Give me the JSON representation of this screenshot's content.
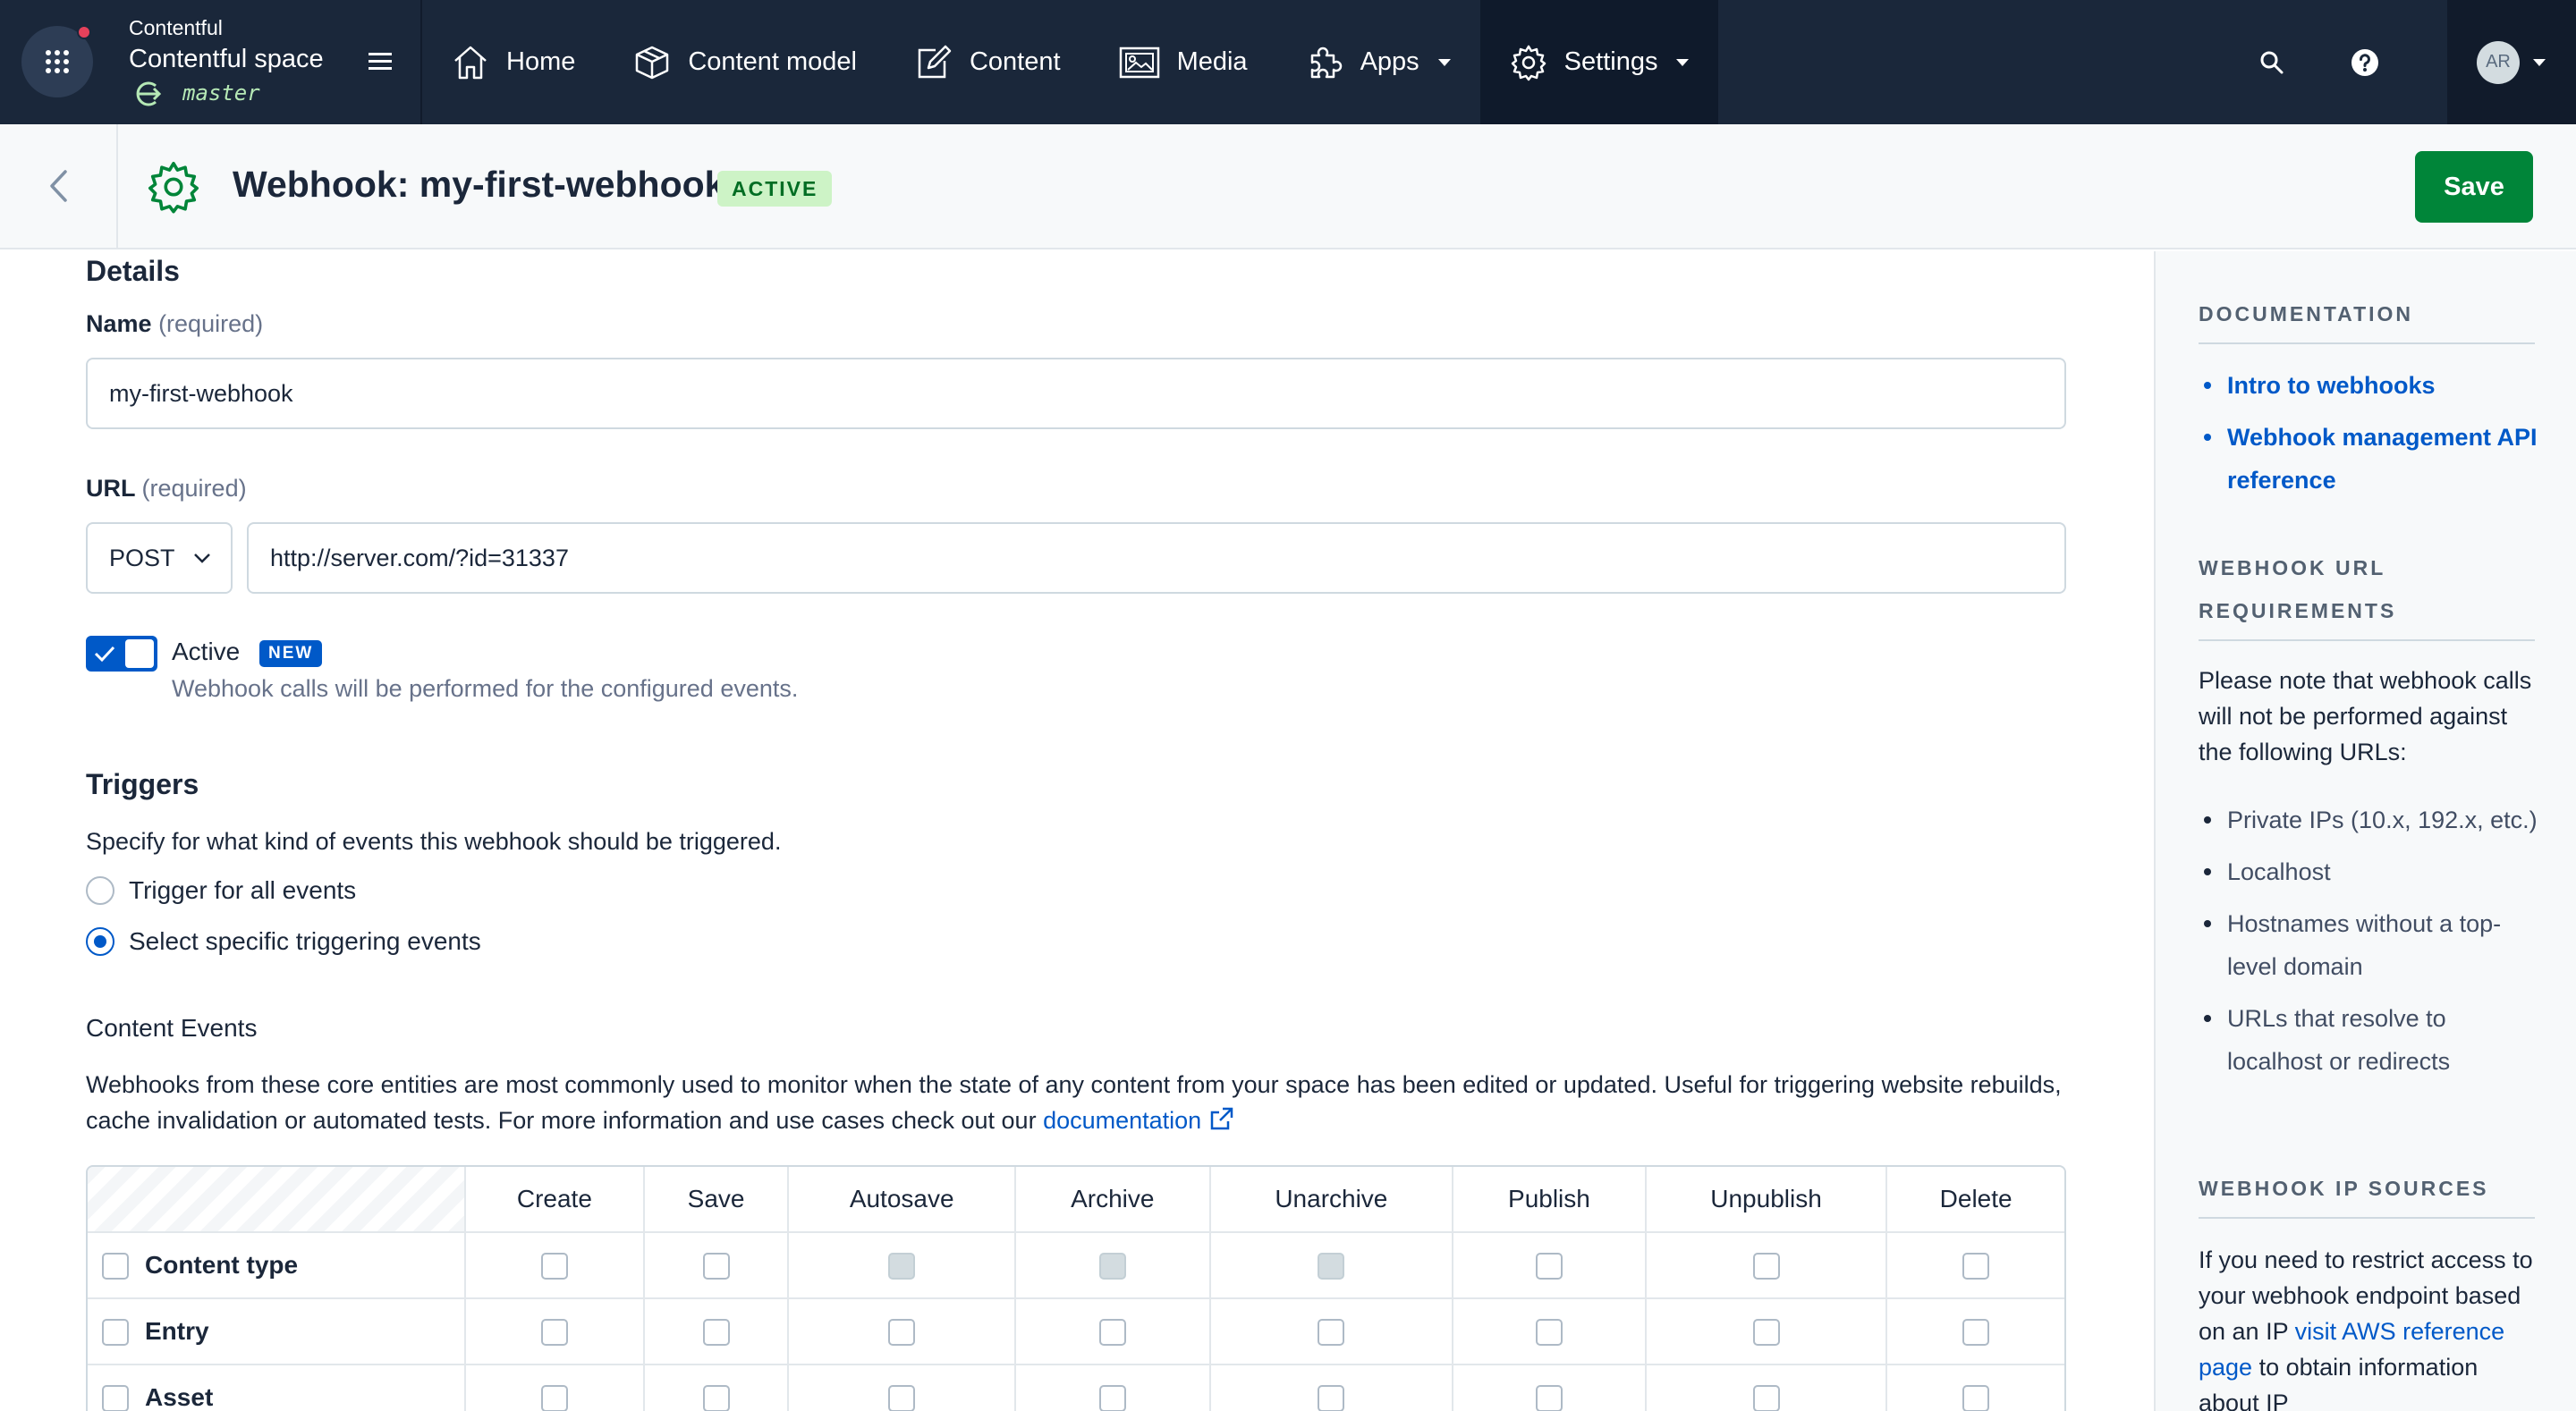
{
  "nav": {
    "org_name": "Contentful",
    "space_name": "Contentful space",
    "environment": "master",
    "items": [
      {
        "label": "Home",
        "icon": "home-icon"
      },
      {
        "label": "Content model",
        "icon": "content-model-icon"
      },
      {
        "label": "Content",
        "icon": "edit-icon"
      },
      {
        "label": "Media",
        "icon": "media-icon"
      },
      {
        "label": "Apps",
        "icon": "puzzle-icon"
      },
      {
        "label": "Settings",
        "icon": "gear-icon"
      }
    ],
    "avatar_initials": "AR",
    "accent_color": "#1a273a"
  },
  "header": {
    "title": "Webhook: my-first-webhook",
    "status": "ACTIVE",
    "save_label": "Save"
  },
  "details": {
    "section_title": "Details",
    "name_label": "Name",
    "name_required": "(required)",
    "name_value": "my-first-webhook",
    "url_label": "URL",
    "url_required": "(required)",
    "method": "POST",
    "url_value": "http://server.com/?id=31337",
    "active_label": "Active",
    "new_badge": "NEW",
    "active_help": "Webhook calls will be performed for the configured events."
  },
  "triggers": {
    "section_title": "Triggers",
    "description": "Specify for what kind of events this webhook should be triggered.",
    "option_all": "Trigger for all events",
    "option_specific": "Select specific triggering events",
    "selected": "specific"
  },
  "content_events": {
    "title": "Content Events",
    "description_1": "Webhooks from these core entities are most commonly used to monitor when the state of any content from your space has been edited or updated. Useful for triggering website rebuilds, cache invalidation or automated tests. For more information and use cases check out our ",
    "link_text": "documentation",
    "columns": [
      "Create",
      "Save",
      "Autosave",
      "Archive",
      "Unarchive",
      "Publish",
      "Unpublish",
      "Delete"
    ],
    "rows": [
      {
        "label": "Content type",
        "disabled": [
          false,
          false,
          true,
          true,
          true,
          false,
          false,
          false
        ]
      },
      {
        "label": "Entry",
        "disabled": [
          false,
          false,
          false,
          false,
          false,
          false,
          false,
          false
        ]
      },
      {
        "label": "Asset",
        "disabled": [
          false,
          false,
          false,
          false,
          false,
          false,
          false,
          false
        ]
      }
    ]
  },
  "sidebar": {
    "doc_heading": "DOCUMENTATION",
    "doc_links": [
      "Intro to webhooks",
      "Webhook management API reference"
    ],
    "url_req_heading": "WEBHOOK URL REQUIREMENTS",
    "url_req_text": "Please note that webhook calls will not be performed against the following URLs:",
    "url_req_items": [
      "Private IPs (10.x, 192.x, etc.)",
      "Localhost",
      "Hostnames without a top-level domain",
      "URLs that resolve to localhost or redirects"
    ],
    "ip_heading": "WEBHOOK IP SOURCES",
    "ip_text": "If you need to restrict access to your webhook endpoint based on an IP",
    "ip_link": "visit AWS reference page",
    "ip_text_2": " to obtain information about IP"
  }
}
